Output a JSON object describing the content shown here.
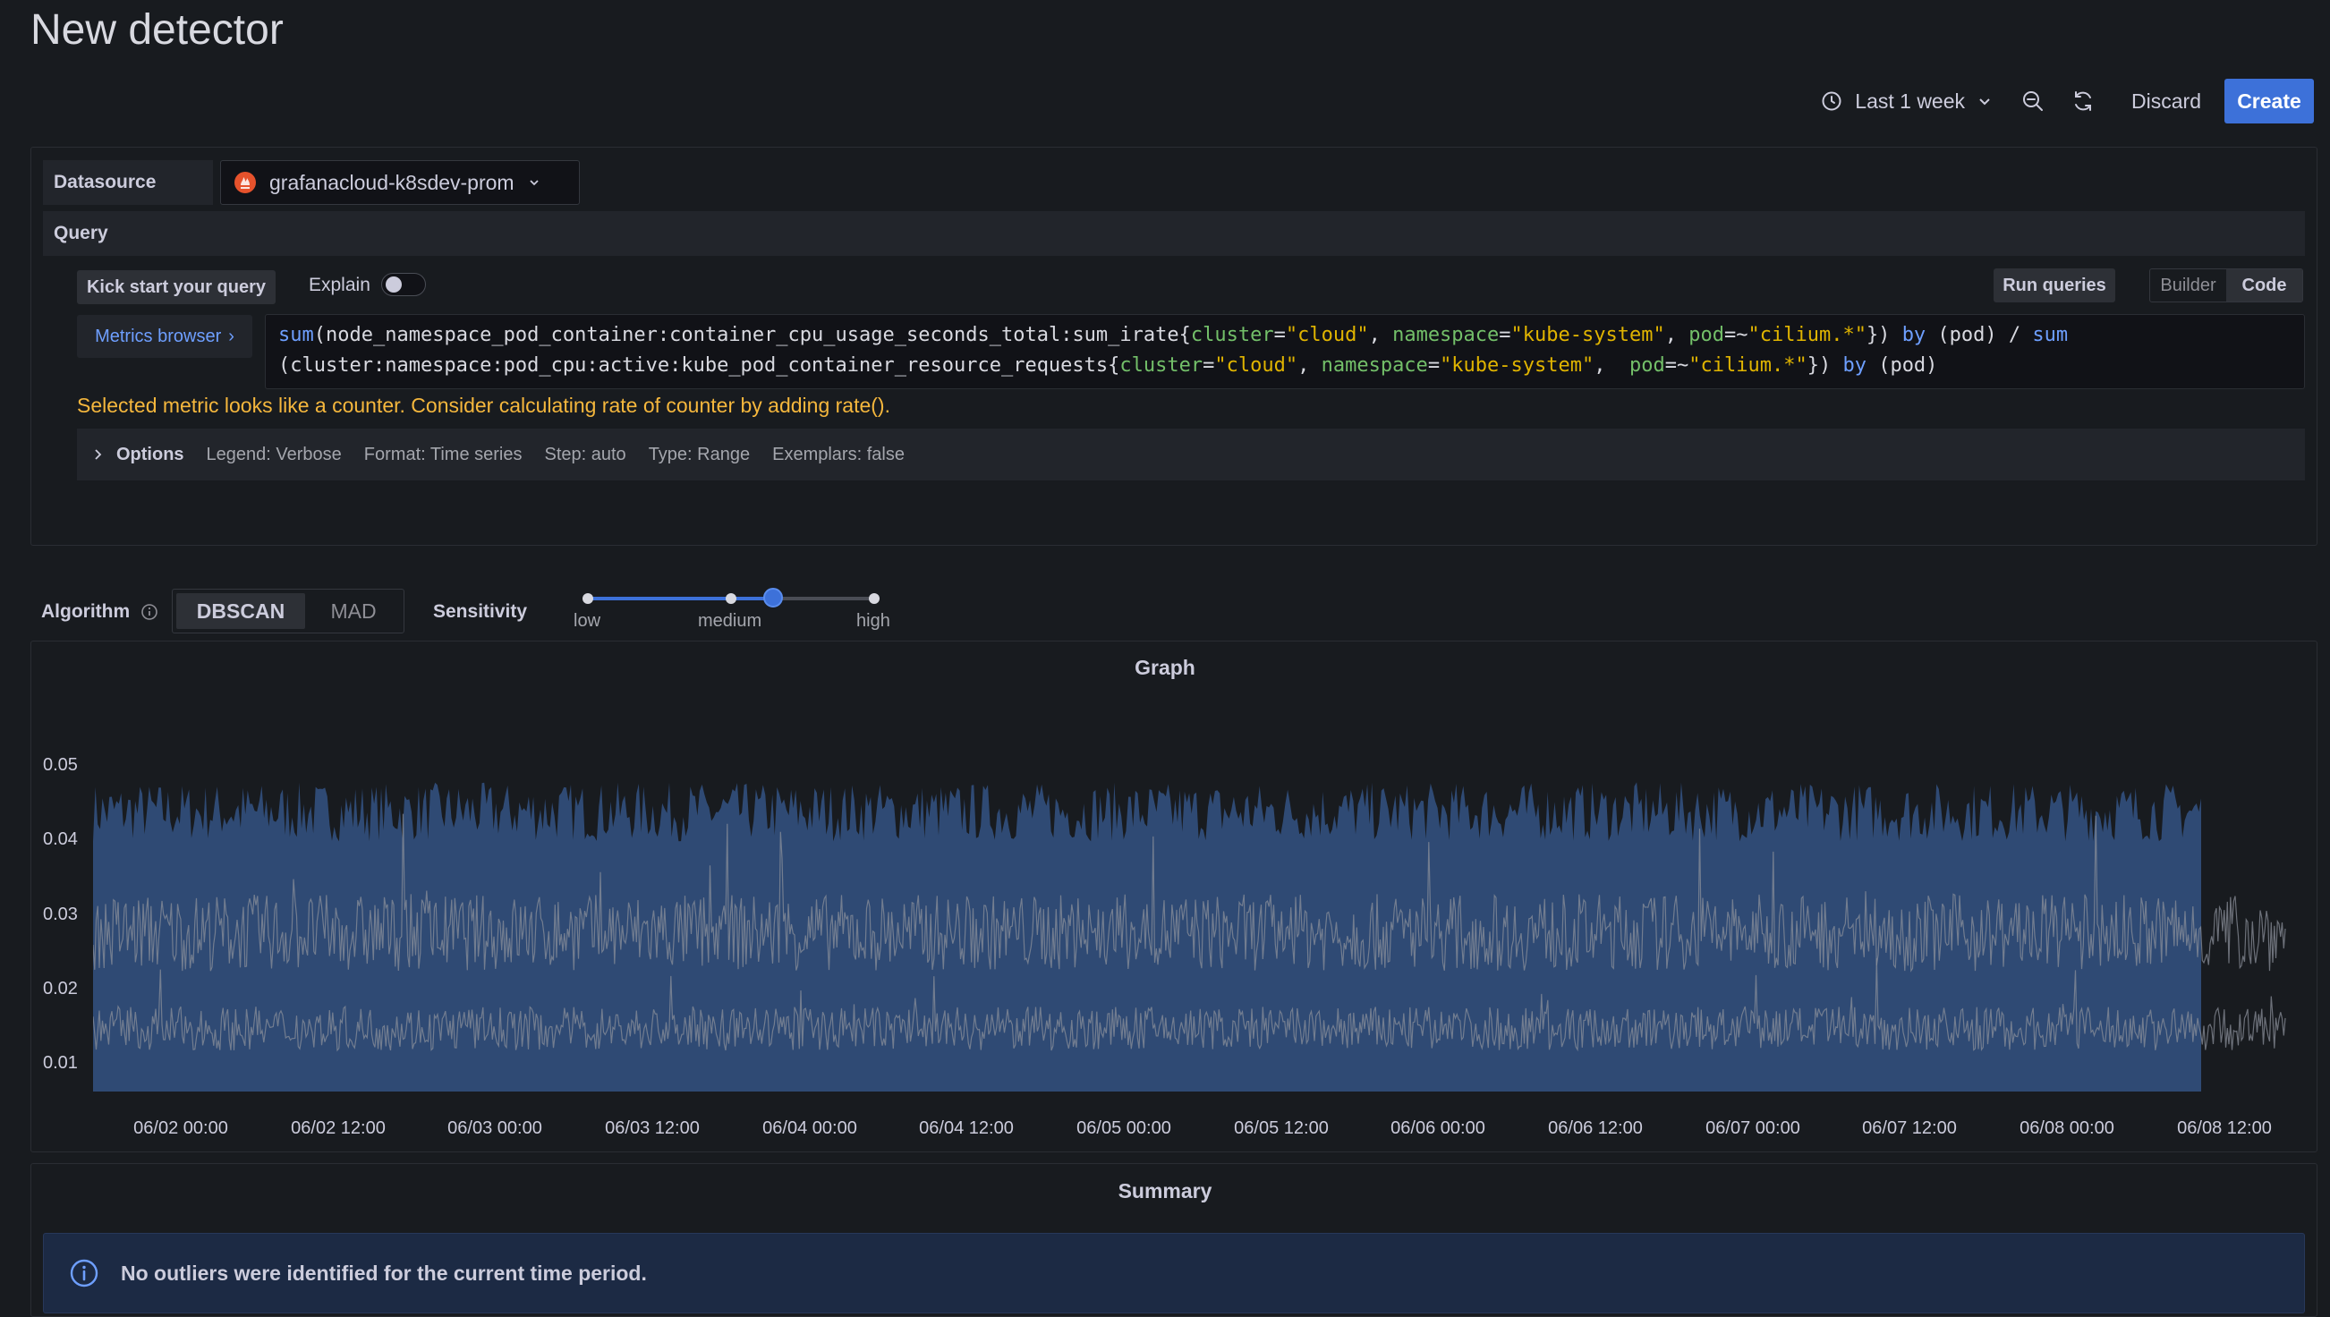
{
  "page": {
    "title": "New detector"
  },
  "toolbar": {
    "time_range": "Last 1 week",
    "discard_label": "Discard",
    "create_label": "Create",
    "icons": [
      "clock-icon",
      "chevron-down-icon",
      "zoom-out-icon",
      "refresh-icon"
    ]
  },
  "datasource": {
    "label": "Datasource",
    "selected": "grafanacloud-k8sdev-prom",
    "icon": "prometheus-icon",
    "icon_color": "#e6522c"
  },
  "query": {
    "section_label": "Query",
    "kick_start_label": "Kick start your query",
    "explain_label": "Explain",
    "explain_on": false,
    "run_queries_label": "Run queries",
    "modes": [
      "Builder",
      "Code"
    ],
    "active_mode": "Code",
    "metrics_browser_label": "Metrics browser",
    "code_line1": "sum(node_namespace_pod_container:container_cpu_usage_seconds_total:sum_irate{cluster=\"cloud\", namespace=\"kube-system\", pod=~\"cilium.*\"}) by (pod) / sum",
    "code_line2": "(cluster:namespace:pod_cpu:active:kube_pod_container_resource_requests{cluster=\"cloud\", namespace=\"kube-system\",  pod=~\"cilium.*\"}) by (pod)",
    "warning": "Selected metric looks like a counter. Consider calculating rate of counter by adding rate().",
    "warning_color": "#f5b73d",
    "options": {
      "title": "Options",
      "legend": "Legend: Verbose",
      "format": "Format: Time series",
      "step": "Step: auto",
      "type": "Type: Range",
      "exemplars": "Exemplars: false"
    }
  },
  "algorithm": {
    "label": "Algorithm",
    "options": [
      "DBSCAN",
      "MAD"
    ],
    "selected": "DBSCAN",
    "sensitivity_label": "Sensitivity",
    "sensitivity_ticks": [
      "low",
      "medium",
      "high"
    ],
    "sensitivity_value": 0.65
  },
  "graph": {
    "title": "Graph",
    "accent": "#3d71d9",
    "band_color": "#2f4a74",
    "outlier_line_color": "#8a8f99"
  },
  "chart_data": {
    "type": "area",
    "title": "Graph",
    "ylim": [
      0,
      0.062
    ],
    "y_ticks": [
      "0.01",
      "0.02",
      "0.03",
      "0.04",
      "0.05"
    ],
    "x_ticks": [
      "06/02 00:00",
      "06/02 12:00",
      "06/03 00:00",
      "06/03 12:00",
      "06/04 00:00",
      "06/04 12:00",
      "06/05 00:00",
      "06/05 12:00",
      "06/06 00:00",
      "06/06 12:00",
      "06/07 00:00",
      "06/07 12:00",
      "06/08 00:00",
      "06/08 12:00"
    ],
    "series": [
      {
        "name": "",
        "kind": "band",
        "lower": 0.0,
        "upper_mean": 0.051,
        "upper_max": 0.057
      },
      {
        "name": "",
        "kind": "line",
        "mean": 0.029,
        "range": [
          0.022,
          0.036
        ]
      },
      {
        "name": "",
        "kind": "line",
        "mean": 0.0115,
        "range": [
          0.008,
          0.016
        ]
      }
    ],
    "grid": false
  },
  "summary": {
    "title": "Summary",
    "message": "No outliers were identified for the current time period."
  }
}
